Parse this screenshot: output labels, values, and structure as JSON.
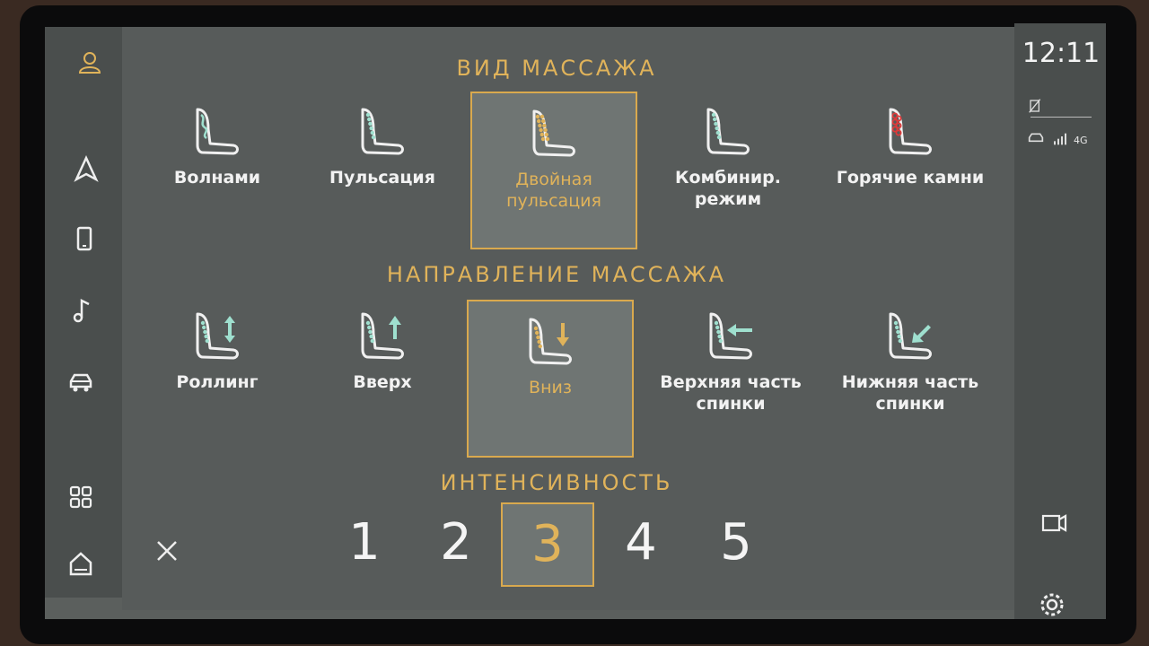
{
  "status": {
    "time": "12:11",
    "network": "4G"
  },
  "sections": {
    "type_title": "ВИД МАССАЖА",
    "direction_title": "НАПРАВЛЕНИЕ МАССАЖА",
    "intensity_title": "ИНТЕНСИВНОСТЬ"
  },
  "massage_types": [
    {
      "label": "Волнами"
    },
    {
      "label": "Пульсация"
    },
    {
      "label": "Двойная\nпульсация",
      "selected": true
    },
    {
      "label": "Комбинир.\nрежим"
    },
    {
      "label": "Горячие камни"
    }
  ],
  "directions": [
    {
      "label": "Роллинг"
    },
    {
      "label": "Вверх"
    },
    {
      "label": "Вниз",
      "selected": true
    },
    {
      "label": "Верхняя часть\nспинки"
    },
    {
      "label": "Нижняя часть\nспинки"
    }
  ],
  "intensity": {
    "levels": [
      "1",
      "2",
      "3",
      "4",
      "5"
    ],
    "selected": "3"
  },
  "colors": {
    "accent": "#e0b35a",
    "icon_teal": "#9fe0cf",
    "hot_red": "#e03a3a"
  }
}
